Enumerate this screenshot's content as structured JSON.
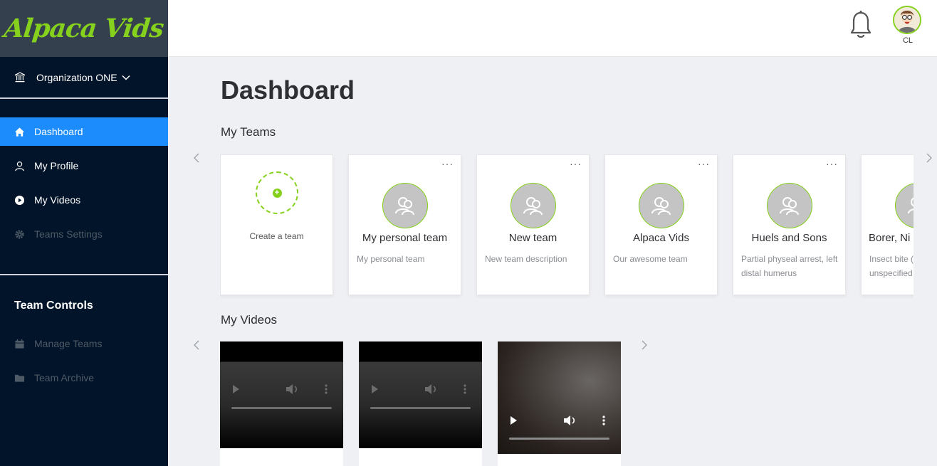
{
  "app": {
    "logo": "Alpaca Vids"
  },
  "org": {
    "name": "Organization ONE"
  },
  "nav": {
    "items": [
      {
        "label": "Dashboard"
      },
      {
        "label": "My Profile"
      },
      {
        "label": "My Videos"
      },
      {
        "label": "Teams Settings"
      }
    ]
  },
  "team_controls": {
    "title": "Team Controls",
    "items": [
      {
        "label": "Manage Teams"
      },
      {
        "label": "Team Archive"
      }
    ]
  },
  "header": {
    "user_initials": "CL"
  },
  "page": {
    "title": "Dashboard"
  },
  "teams": {
    "title": "My Teams",
    "create_label": "Create a team",
    "more": "···",
    "items": [
      {
        "name": "My personal team",
        "desc": "My personal team"
      },
      {
        "name": "New team",
        "desc": "New team description"
      },
      {
        "name": "Alpaca Vids",
        "desc": "Our awesome team"
      },
      {
        "name": "Huels and Sons",
        "desc": "Partial physeal arrest, left distal humerus"
      },
      {
        "name": "Borer, Ni",
        "desc": "Insect bite (nonvenomo unspecified sequela"
      }
    ]
  },
  "videos": {
    "title": "My Videos"
  },
  "colors": {
    "accent": "#86d11d",
    "active": "#1c8cfd",
    "sidebar": "#021429"
  }
}
